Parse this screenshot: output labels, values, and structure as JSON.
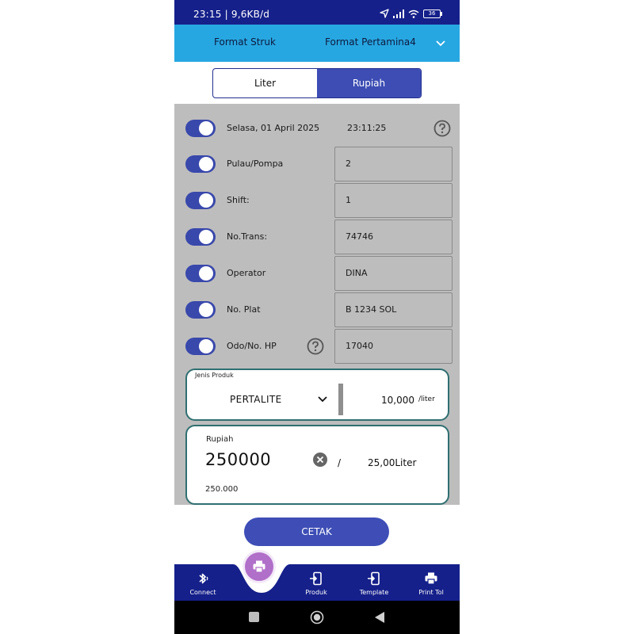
{
  "status_bar": {
    "time_speed": "23:15 | 9,6KB/d",
    "battery": "36"
  },
  "app_bar": {
    "title": "Format Struk",
    "selected_format": "Format Pertamina4"
  },
  "mode_toggle": {
    "options": [
      "Liter",
      "Rupiah"
    ],
    "selected": "Rupiah"
  },
  "fields": [
    {
      "label": "Selasa, 01 April 2025",
      "value": "23:11:25",
      "enabled": true,
      "has_help": true
    },
    {
      "label": "Pulau/Pompa",
      "value": "2",
      "enabled": true
    },
    {
      "label": "Shift:",
      "value": "1",
      "enabled": true
    },
    {
      "label": "No.Trans:",
      "value": "74746",
      "enabled": true
    },
    {
      "label": "Operator",
      "value": "DINA",
      "enabled": true
    },
    {
      "label": "No. Plat",
      "value": "B 1234 SOL",
      "enabled": true
    },
    {
      "label": "Odo/No. HP",
      "value": "17040",
      "enabled": true,
      "has_help": true
    }
  ],
  "product": {
    "label": "Jenis Produk",
    "name": "PERTALITE",
    "price": "10,000",
    "unit": "/liter"
  },
  "amount": {
    "label": "Rupiah",
    "value": "250000",
    "separator": "/",
    "liters": "25,00Liter",
    "formatted": "250.000"
  },
  "print_button": "CETAK",
  "bottom_nav": [
    {
      "label": "Connect",
      "icon": "bluetooth-icon"
    },
    {
      "label": "Produk",
      "icon": "phone-import-icon"
    },
    {
      "label": "Template",
      "icon": "phone-import-icon"
    },
    {
      "label": "Print Tol",
      "icon": "printer-icon"
    }
  ],
  "colors": {
    "status_bar": "#15208a",
    "app_bar": "#27a7e1",
    "accent": "#3e4eb6",
    "fab": "#b06fc9",
    "panel": "#bdbdbd"
  }
}
